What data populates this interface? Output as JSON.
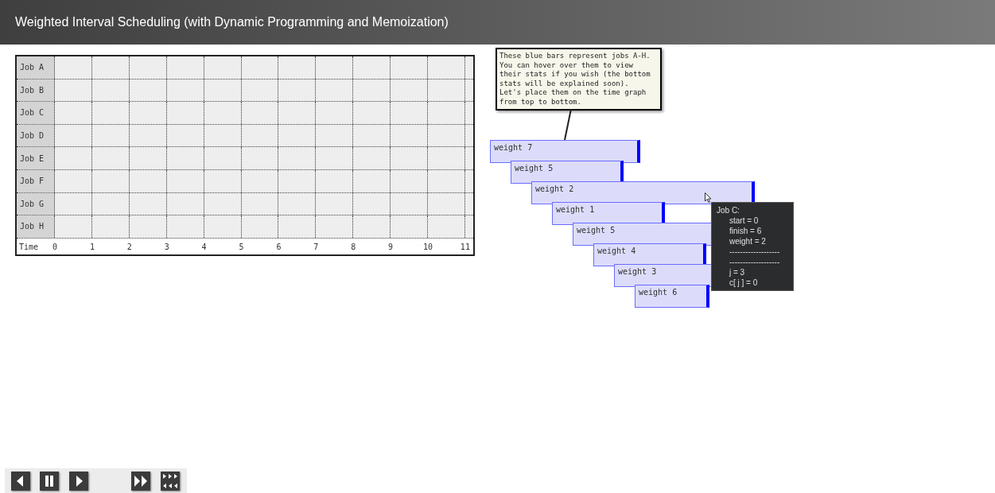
{
  "header": {
    "title": "Weighted Interval Scheduling (with Dynamic Programming and Memoization)"
  },
  "grid": {
    "rows": [
      "Job A",
      "Job B",
      "Job C",
      "Job D",
      "Job E",
      "Job F",
      "Job G",
      "Job H"
    ],
    "axis_label": "Time",
    "ticks": [
      "0",
      "1",
      "2",
      "3",
      "4",
      "5",
      "6",
      "7",
      "8",
      "9",
      "10",
      "11"
    ]
  },
  "callout": {
    "lines": [
      "These blue bars represent jobs A-H.",
      "You can hover over them to view",
      "their stats if you wish (the bottom",
      "stats will be explained soon).",
      "Let's place them on the time graph",
      "from top to bottom."
    ]
  },
  "bars": [
    {
      "label": "weight 7"
    },
    {
      "label": "weight 5"
    },
    {
      "label": "weight 2"
    },
    {
      "label": "weight 1"
    },
    {
      "label": "weight 5"
    },
    {
      "label": "weight 4"
    },
    {
      "label": "weight 3"
    },
    {
      "label": "weight 6"
    }
  ],
  "tooltip": {
    "title": "Job C:",
    "lines": [
      "start = 0",
      "finish = 6",
      "weight = 2",
      "-------------------",
      "-------------------",
      "j = 3",
      "c[ j ] = 0"
    ]
  },
  "controls": [
    {
      "kind": "back"
    },
    {
      "kind": "pause"
    },
    {
      "kind": "play"
    },
    {
      "kind": "forward"
    },
    {
      "kind": "skip"
    }
  ]
}
